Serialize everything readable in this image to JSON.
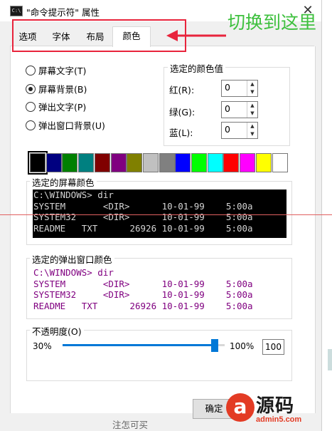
{
  "window": {
    "title": "\"命令提示符\" 属性",
    "close_glyph": "✕",
    "icon_glyph": "C:\\"
  },
  "tabs": [
    {
      "label": "选项",
      "active": false
    },
    {
      "label": "字体",
      "active": false
    },
    {
      "label": "布局",
      "active": false
    },
    {
      "label": "颜色",
      "active": true
    }
  ],
  "annotation": {
    "text": "切换到这里",
    "arrow_color": "#e8243c",
    "text_color": "#3ec03e"
  },
  "radios": [
    {
      "label": "屏幕文字(T)",
      "checked": false
    },
    {
      "label": "屏幕背景(B)",
      "checked": true
    },
    {
      "label": "弹出文字(P)",
      "checked": false
    },
    {
      "label": "弹出窗口背景(U)",
      "checked": false
    }
  ],
  "color_values": {
    "group_title": "选定的颜色值",
    "red_label": "红(R):",
    "red_value": "0",
    "green_label": "绿(G):",
    "green_value": "0",
    "blue_label": "蓝(L):",
    "blue_value": "0"
  },
  "palette": [
    "#000000",
    "#000080",
    "#008000",
    "#008080",
    "#800000",
    "#800080",
    "#808000",
    "#c0c0c0",
    "#808080",
    "#0000ff",
    "#00ff00",
    "#00ffff",
    "#ff0000",
    "#ff00ff",
    "#ffff00",
    "#ffffff"
  ],
  "screen_colors": {
    "group_title": "选定的屏幕颜色",
    "lines": [
      "C:\\WINDOWS> dir",
      "SYSTEM       <DIR>      10-01-99    5:00a",
      "SYSTEM32     <DIR>      10-01-99    5:00a",
      "README   TXT      26926 10-01-99    5:00a"
    ]
  },
  "popup_colors": {
    "group_title": "选定的弹出窗口颜色",
    "lines": [
      "C:\\WINDOWS> dir",
      "SYSTEM       <DIR>      10-01-99    5:00a",
      "SYSTEM32     <DIR>      10-01-99    5:00a",
      "README   TXT      26926 10-01-99    5:00a"
    ]
  },
  "opacity": {
    "group_title": "不透明度(O)",
    "min_label": "30%",
    "max_label": "100%",
    "value": "100",
    "level_percent": 100
  },
  "buttons": {
    "ok_label": "确定"
  },
  "background_text": "注怎可买",
  "watermark": {
    "text": "源码",
    "url": "admin5.com",
    "badge": "a"
  }
}
